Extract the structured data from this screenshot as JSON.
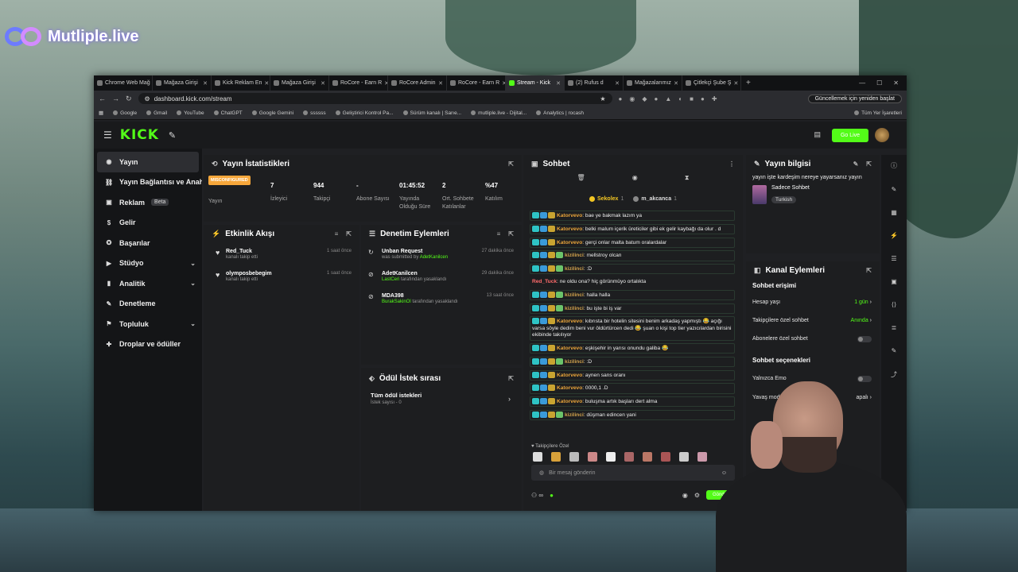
{
  "overlay": {
    "brand": "Mutliple.live"
  },
  "browser": {
    "tabs": [
      {
        "label": "Chrome Web Mağ",
        "active": false
      },
      {
        "label": "Mağaza Girişi",
        "active": false
      },
      {
        "label": "Kick Reklam En",
        "active": false
      },
      {
        "label": "Mağaza Girişi",
        "active": false
      },
      {
        "label": "RoCore - Earn R",
        "active": false
      },
      {
        "label": "RoCore Admin",
        "active": false
      },
      {
        "label": "RoCore - Earn R",
        "active": false
      },
      {
        "label": "Stream - Kick",
        "active": true
      },
      {
        "label": "(2) Rufus d",
        "active": false
      },
      {
        "label": "Mağazalarımız",
        "active": false
      },
      {
        "label": "Çitlekçi Şube Ş",
        "active": false
      }
    ],
    "url": "dashboard.kick.com/stream",
    "update_label": "Güncellemek için yeniden başlat",
    "bookmarks": [
      "Google",
      "Gmail",
      "YouTube",
      "ChatGPT",
      "Google Gemini",
      "ssssss",
      "Geliştirici Kontrol Pa...",
      "Sürüm kanalı | Sarıe...",
      "mutliple.live - Dijital...",
      "Analytics | rocash"
    ],
    "all_bookmarks": "Tüm Yer İşaretleri"
  },
  "kick": {
    "logo": "KICK",
    "golive": "Go Live"
  },
  "sidebar": [
    {
      "label": "Yayın",
      "icon": "broadcast-icon",
      "active": true,
      "chevron": false
    },
    {
      "label": "Yayın Bağlantısı ve Anahtarı",
      "icon": "link-icon",
      "active": false,
      "chevron": false
    },
    {
      "label": "Reklam",
      "icon": "ad-icon",
      "active": false,
      "chevron": false,
      "badge": "Beta"
    },
    {
      "label": "Gelir",
      "icon": "money-icon",
      "active": false,
      "chevron": false
    },
    {
      "label": "Başarılar",
      "icon": "trophy-icon",
      "active": false,
      "chevron": false
    },
    {
      "label": "Stüdyo",
      "icon": "studio-icon",
      "active": false,
      "chevron": true
    },
    {
      "label": "Analitik",
      "icon": "analytics-icon",
      "active": false,
      "chevron": true
    },
    {
      "label": "Denetleme",
      "icon": "moderation-icon",
      "active": false,
      "chevron": false
    },
    {
      "label": "Topluluk",
      "icon": "community-icon",
      "active": false,
      "chevron": true
    },
    {
      "label": "Droplar ve ödüller",
      "icon": "gift-icon",
      "active": false,
      "chevron": false
    }
  ],
  "stats": {
    "title": "Yayın İstatistikleri",
    "misconfigured": "MISCONFIGURED",
    "items": [
      {
        "value": "",
        "label": "Yayın"
      },
      {
        "value": "7",
        "label": "İzleyici"
      },
      {
        "value": "944",
        "label": "Takipçi"
      },
      {
        "value": "-",
        "label": "Abone Sayısı"
      },
      {
        "value": "01:45:52",
        "label": "Yayında Olduğu Süre"
      },
      {
        "value": "2",
        "label": "Ort. Sohbete Katılanlar"
      },
      {
        "value": "%47",
        "label": "Katılım"
      }
    ]
  },
  "activity": {
    "title": "Etkinlik Akışı",
    "items": [
      {
        "name": "Red_Tuck",
        "sub": "kanalı takip etti",
        "time": "1 saat önce"
      },
      {
        "name": "olymposbebegim",
        "sub": "kanalı takip etti",
        "time": "1 saat önce"
      }
    ]
  },
  "moderation": {
    "title": "Denetim Eylemleri",
    "items": [
      {
        "name": "Unban Request",
        "pre": "was submitted by",
        "actor": "AdetKanilcen",
        "post": "",
        "time": "27 dakika önce"
      },
      {
        "name": "AdetKanilcen",
        "pre": "",
        "actor": "LastCeri",
        "post": "tarafından yasaklandı",
        "time": "29 dakika önce"
      },
      {
        "name": "MDA398",
        "pre": "",
        "actor": "BurakSakinOl",
        "post": "tarafından yasaklandı",
        "time": "13 saat önce"
      }
    ]
  },
  "rewards": {
    "title": "Ödül İstek sırası",
    "all": "Tüm ödül istekleri",
    "count": "İstek sayısı - 0"
  },
  "chat": {
    "title": "Sohbet",
    "pinned": [
      {
        "name": "Sekolex",
        "count": "1"
      },
      {
        "name": "m_akcanca",
        "count": "1"
      }
    ],
    "messages": [
      {
        "user": "Katorvevo",
        "text": "bae ye bakmak lazım ya",
        "style": "u1",
        "badges": 3
      },
      {
        "user": "Katorvevo",
        "text": "belki malum içerik üreticiler gibi ek gelir kaybağı da olur . d",
        "style": "u1",
        "badges": 3
      },
      {
        "user": "Katorvevo",
        "text": "gerçi onlar malta batum oralardalar",
        "style": "u1",
        "badges": 3
      },
      {
        "user": "kizilinci",
        "text": "mellstroy olcan",
        "style": "u2",
        "badges": 4
      },
      {
        "user": "kizilinci",
        "text": ":D",
        "style": "u2",
        "badges": 4
      },
      {
        "user": "Red_Tuck",
        "text": "ne oldu ona? hiç görünmüyo ortalıkta",
        "style": "u3",
        "badges": 0
      },
      {
        "user": "kizilinci",
        "text": "halla halla",
        "style": "u2",
        "badges": 4
      },
      {
        "user": "kizilinci",
        "text": "bu işte bi iş var",
        "style": "u2",
        "badges": 4
      },
      {
        "user": "Katorvevo",
        "text": "kıbrısta bir hotelin sitesini benim arkadaş yapmıştı 😂 açığı varsa söyle dedim beni vur öldürtürcen dedi 😂 şuan o kişi top tier yazıcılardan birisini ekibinde takılıyor",
        "style": "u1",
        "badges": 3
      },
      {
        "user": "Katorvevo",
        "text": "eşkişehir in yarısı onundu galiba 😂",
        "style": "u1",
        "badges": 3
      },
      {
        "user": "kizilinci",
        "text": ":D",
        "style": "u2",
        "badges": 4
      },
      {
        "user": "Katorvevo",
        "text": "aynen sans oranı",
        "style": "u1",
        "badges": 3
      },
      {
        "user": "Katorvevo",
        "text": "0000,1 .D",
        "style": "u1",
        "badges": 3
      },
      {
        "user": "Katorvevo",
        "text": "buluşma artık başları dert alma",
        "style": "u1",
        "badges": 3
      },
      {
        "user": "kizilinci",
        "text": "düşman edincen yani",
        "style": "u2",
        "badges": 4
      }
    ],
    "followers_only": "Takipçilere Özel",
    "placeholder": "Bir mesaj gönderin",
    "send": "Gönder"
  },
  "streaminfo": {
    "title": "Yayın bilgisi",
    "stream_title": "yayın işte kardeşim nereye yayarsanız yayın",
    "category": "Sadece Sohbet",
    "tag": "Turkish"
  },
  "channel": {
    "title": "Kanal Eylemleri",
    "access_title": "Sohbet erişimi",
    "account_age": "Hesap yaşı",
    "account_age_val": "1 gün",
    "followers_chat": "Takipçilere özel sohbet",
    "followers_chat_val": "Anında",
    "subs_chat": "Abonelere özel sohbet",
    "options_title": "Sohbet seçenekleri",
    "emote_only": "Yalnızca Emo",
    "slow_mode": "Yavaş mod",
    "slow_mode_val": "apalı"
  }
}
